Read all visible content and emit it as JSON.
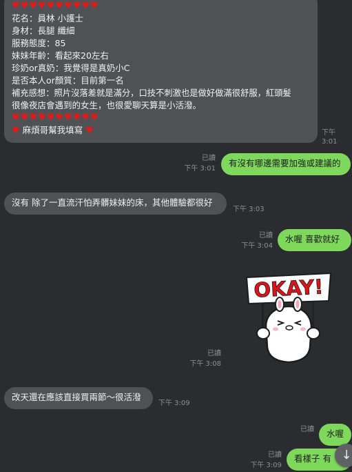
{
  "messages": {
    "m1": {
      "hearts_top": "♥♥♥♥♥♥♥♥♥♥",
      "lines": [
        "花名：員林 小護士",
        "身材：長腿 纖細",
        "服務態度：85",
        "妹妹年齡：看起來20左右",
        "珍奶or真奶：我覺得是真奶小C",
        "是否本人or顏質：目前第一名",
        "補充感想：照片沒落差就是滿分，口技不刺激也是做好做滿很舒服，紅頭髮",
        "很像夜店會遇到的女生，也很愛聊天算是小活潑。"
      ],
      "hearts_bottom": "♥♥♥♥♥♥♥♥♥♥",
      "closing": "麻煩哥幫我填寫",
      "time": "下午 3:01"
    },
    "m2": {
      "text": "有沒有哪邊需要加強或建議的",
      "read": "已讀",
      "time": "下午 3:01"
    },
    "m3": {
      "text": "沒有 除了一直流汗怕弄髒妹妹的床，其他體驗都很好",
      "time": "下午 3:03"
    },
    "m4": {
      "text": "水喔  喜歡就好",
      "read": "已讀",
      "time": "下午 3:04"
    },
    "m5": {
      "sticker_text": "OKAY!",
      "read": "已讀",
      "time": "下午 3:08"
    },
    "m6": {
      "text": "改天還在應該直接買兩節～很活潑",
      "time": "下午 3:09"
    },
    "m7": {
      "text": "水喔",
      "read": "已讀",
      "time": ""
    },
    "m8": {
      "text": "看樣子  有",
      "read": "已讀",
      "time": "下午 3:09"
    }
  },
  "controls": {
    "scroll_down_icon": "↓"
  },
  "colors": {
    "background": "#2b2c30",
    "incoming_bubble": "#505154",
    "outgoing_bubble": "#7ed85c",
    "heart": "#e01a1a"
  }
}
